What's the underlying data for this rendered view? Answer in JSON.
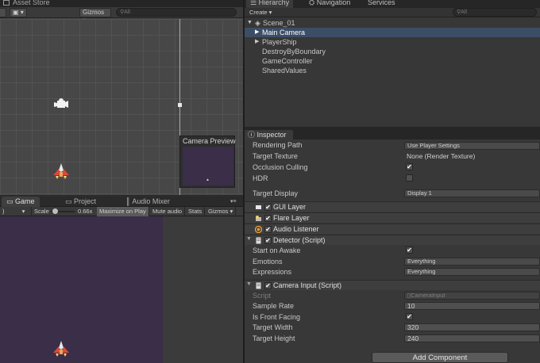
{
  "scene": {
    "tab_label": "Asset Store",
    "gizmos_label": "Gizmos",
    "search_placeholder": "All",
    "camera_preview_title": "Camera Preview"
  },
  "game": {
    "tabs": [
      {
        "label": "Game",
        "icon": "game-controller-icon"
      },
      {
        "label": "Project",
        "icon": "folder-icon"
      },
      {
        "label": "Audio Mixer",
        "icon": "mixer-icon"
      }
    ],
    "toolbar": {
      "display_label": ")",
      "scale_label": "Scale",
      "scale_value": "0.66x",
      "scale_fraction": 0.1,
      "maximize_label": "Maximize on Play",
      "mute_label": "Mute audio",
      "stats_label": "Stats",
      "gizmos_label": "Gizmos"
    }
  },
  "hierarchy": {
    "tabs": [
      "Hierarchy",
      "Navigation",
      "Services"
    ],
    "create_label": "Create",
    "search_placeholder": "All",
    "scene_name": "Scene_01",
    "items": [
      {
        "label": "Main Camera",
        "selected": true,
        "expandable": true
      },
      {
        "label": "PlayerShip",
        "selected": false,
        "expandable": true
      },
      {
        "label": "DestroyByBoundary",
        "selected": false,
        "expandable": false
      },
      {
        "label": "GameController",
        "selected": false,
        "expandable": false
      },
      {
        "label": "SharedValues",
        "selected": false,
        "expandable": false
      }
    ]
  },
  "inspector": {
    "tab_label": "Inspector",
    "camera_props": {
      "rendering_path_label": "Rendering Path",
      "rendering_path_value": "Use Player Settings",
      "target_texture_label": "Target Texture",
      "target_texture_value": "None (Render Texture)",
      "occlusion_culling_label": "Occlusion Culling",
      "hdr_label": "HDR",
      "target_display_label": "Target Display",
      "target_display_value": "Display 1"
    },
    "components": {
      "gui_layer": "GUI Layer",
      "flare_layer": "Flare Layer",
      "audio_listener": "Audio Listener",
      "detector": "Detector (Script)",
      "camera_input": "Camera Input (Script)"
    },
    "detector": {
      "start_on_awake_label": "Start on Awake",
      "emotions_label": "Emotions",
      "emotions_value": "Everything",
      "expressions_label": "Expressions",
      "expressions_value": "Everything"
    },
    "camera_input": {
      "script_label": "Script",
      "script_value": "CameraInput",
      "sample_rate_label": "Sample Rate",
      "sample_rate_value": "10",
      "is_front_facing_label": "Is Front Facing",
      "target_width_label": "Target Width",
      "target_width_value": "320",
      "target_height_label": "Target Height",
      "target_height_value": "240"
    },
    "add_component_label": "Add Component",
    "check_glyph": "✔"
  },
  "colors": {
    "selection": "#3c4e66",
    "game_background": "#3a2e48"
  }
}
